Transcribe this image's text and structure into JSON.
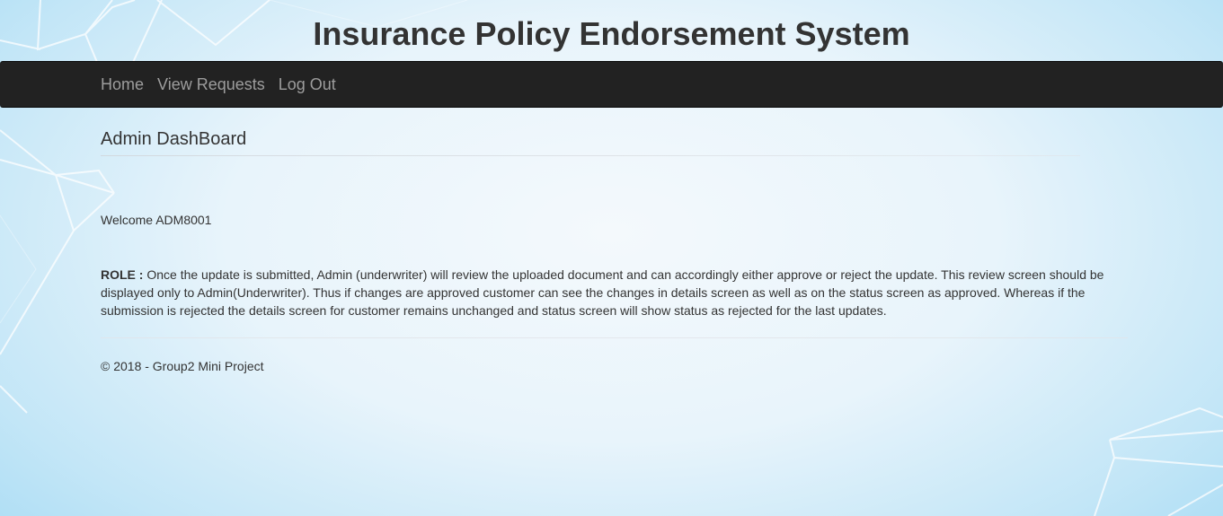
{
  "site": {
    "title": "Insurance Policy Endorsement System"
  },
  "nav": {
    "items": [
      {
        "label": "Home"
      },
      {
        "label": "View Requests"
      },
      {
        "label": "Log Out"
      }
    ],
    "background_color": "#222222",
    "link_color": "#9d9d9d"
  },
  "main": {
    "heading": "Admin DashBoard",
    "welcome": "Welcome ADM8001",
    "role_label": "ROLE :",
    "role_text": " Once the update is submitted, Admin (underwriter) will review the uploaded document and can accordingly either approve or reject the update. This review screen should be displayed only to Admin(Underwriter). Thus if changes are approved customer can see the changes in details screen as well as on the status screen as approved. Whereas if the submission is rejected the details screen for customer remains unchanged and status screen will show status as rejected for the last updates."
  },
  "footer": {
    "text": "© 2018 - Group2 Mini Project"
  },
  "theme": {
    "background_accent": "#a9dcf4",
    "text_color": "#333333"
  }
}
